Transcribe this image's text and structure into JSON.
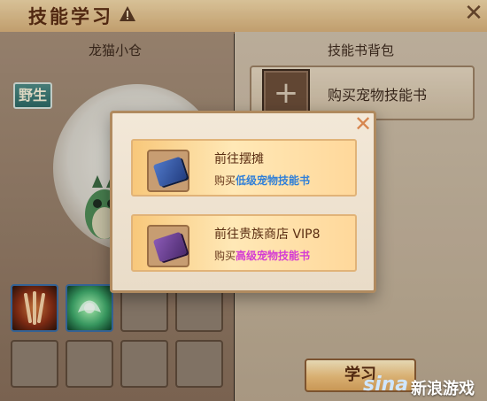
{
  "window": {
    "title": "技能学习",
    "close_label": "✕"
  },
  "left_panel": {
    "title": "龙猫小仓",
    "tag": "野生",
    "skills": [
      {
        "name": "skill-1",
        "icon": "claw-skill-icon"
      },
      {
        "name": "skill-2",
        "icon": "heal-skill-icon"
      }
    ]
  },
  "right_panel": {
    "title": "技能书背包",
    "buy_label": "购买宠物技能书",
    "learn_button": "学习"
  },
  "modal": {
    "close_label": "✕",
    "options": [
      {
        "title": "前往摆摊",
        "prefix": "购买",
        "highlight": "低级宠物技能书",
        "highlight_color": "#2f7fd8",
        "icon": "blue-book-icon"
      },
      {
        "title": "前往贵族商店 VIP8",
        "prefix": "购买",
        "highlight": "高级宠物技能书",
        "highlight_color": "#d43bd4",
        "icon": "purple-book-icon"
      }
    ]
  },
  "watermark": {
    "logo": "sina",
    "text": "新浪游戏"
  },
  "colors": {
    "title_bg": "#e6c58f",
    "modal_bg": "#efe4d2",
    "option_bg": "#ffe1a8"
  }
}
